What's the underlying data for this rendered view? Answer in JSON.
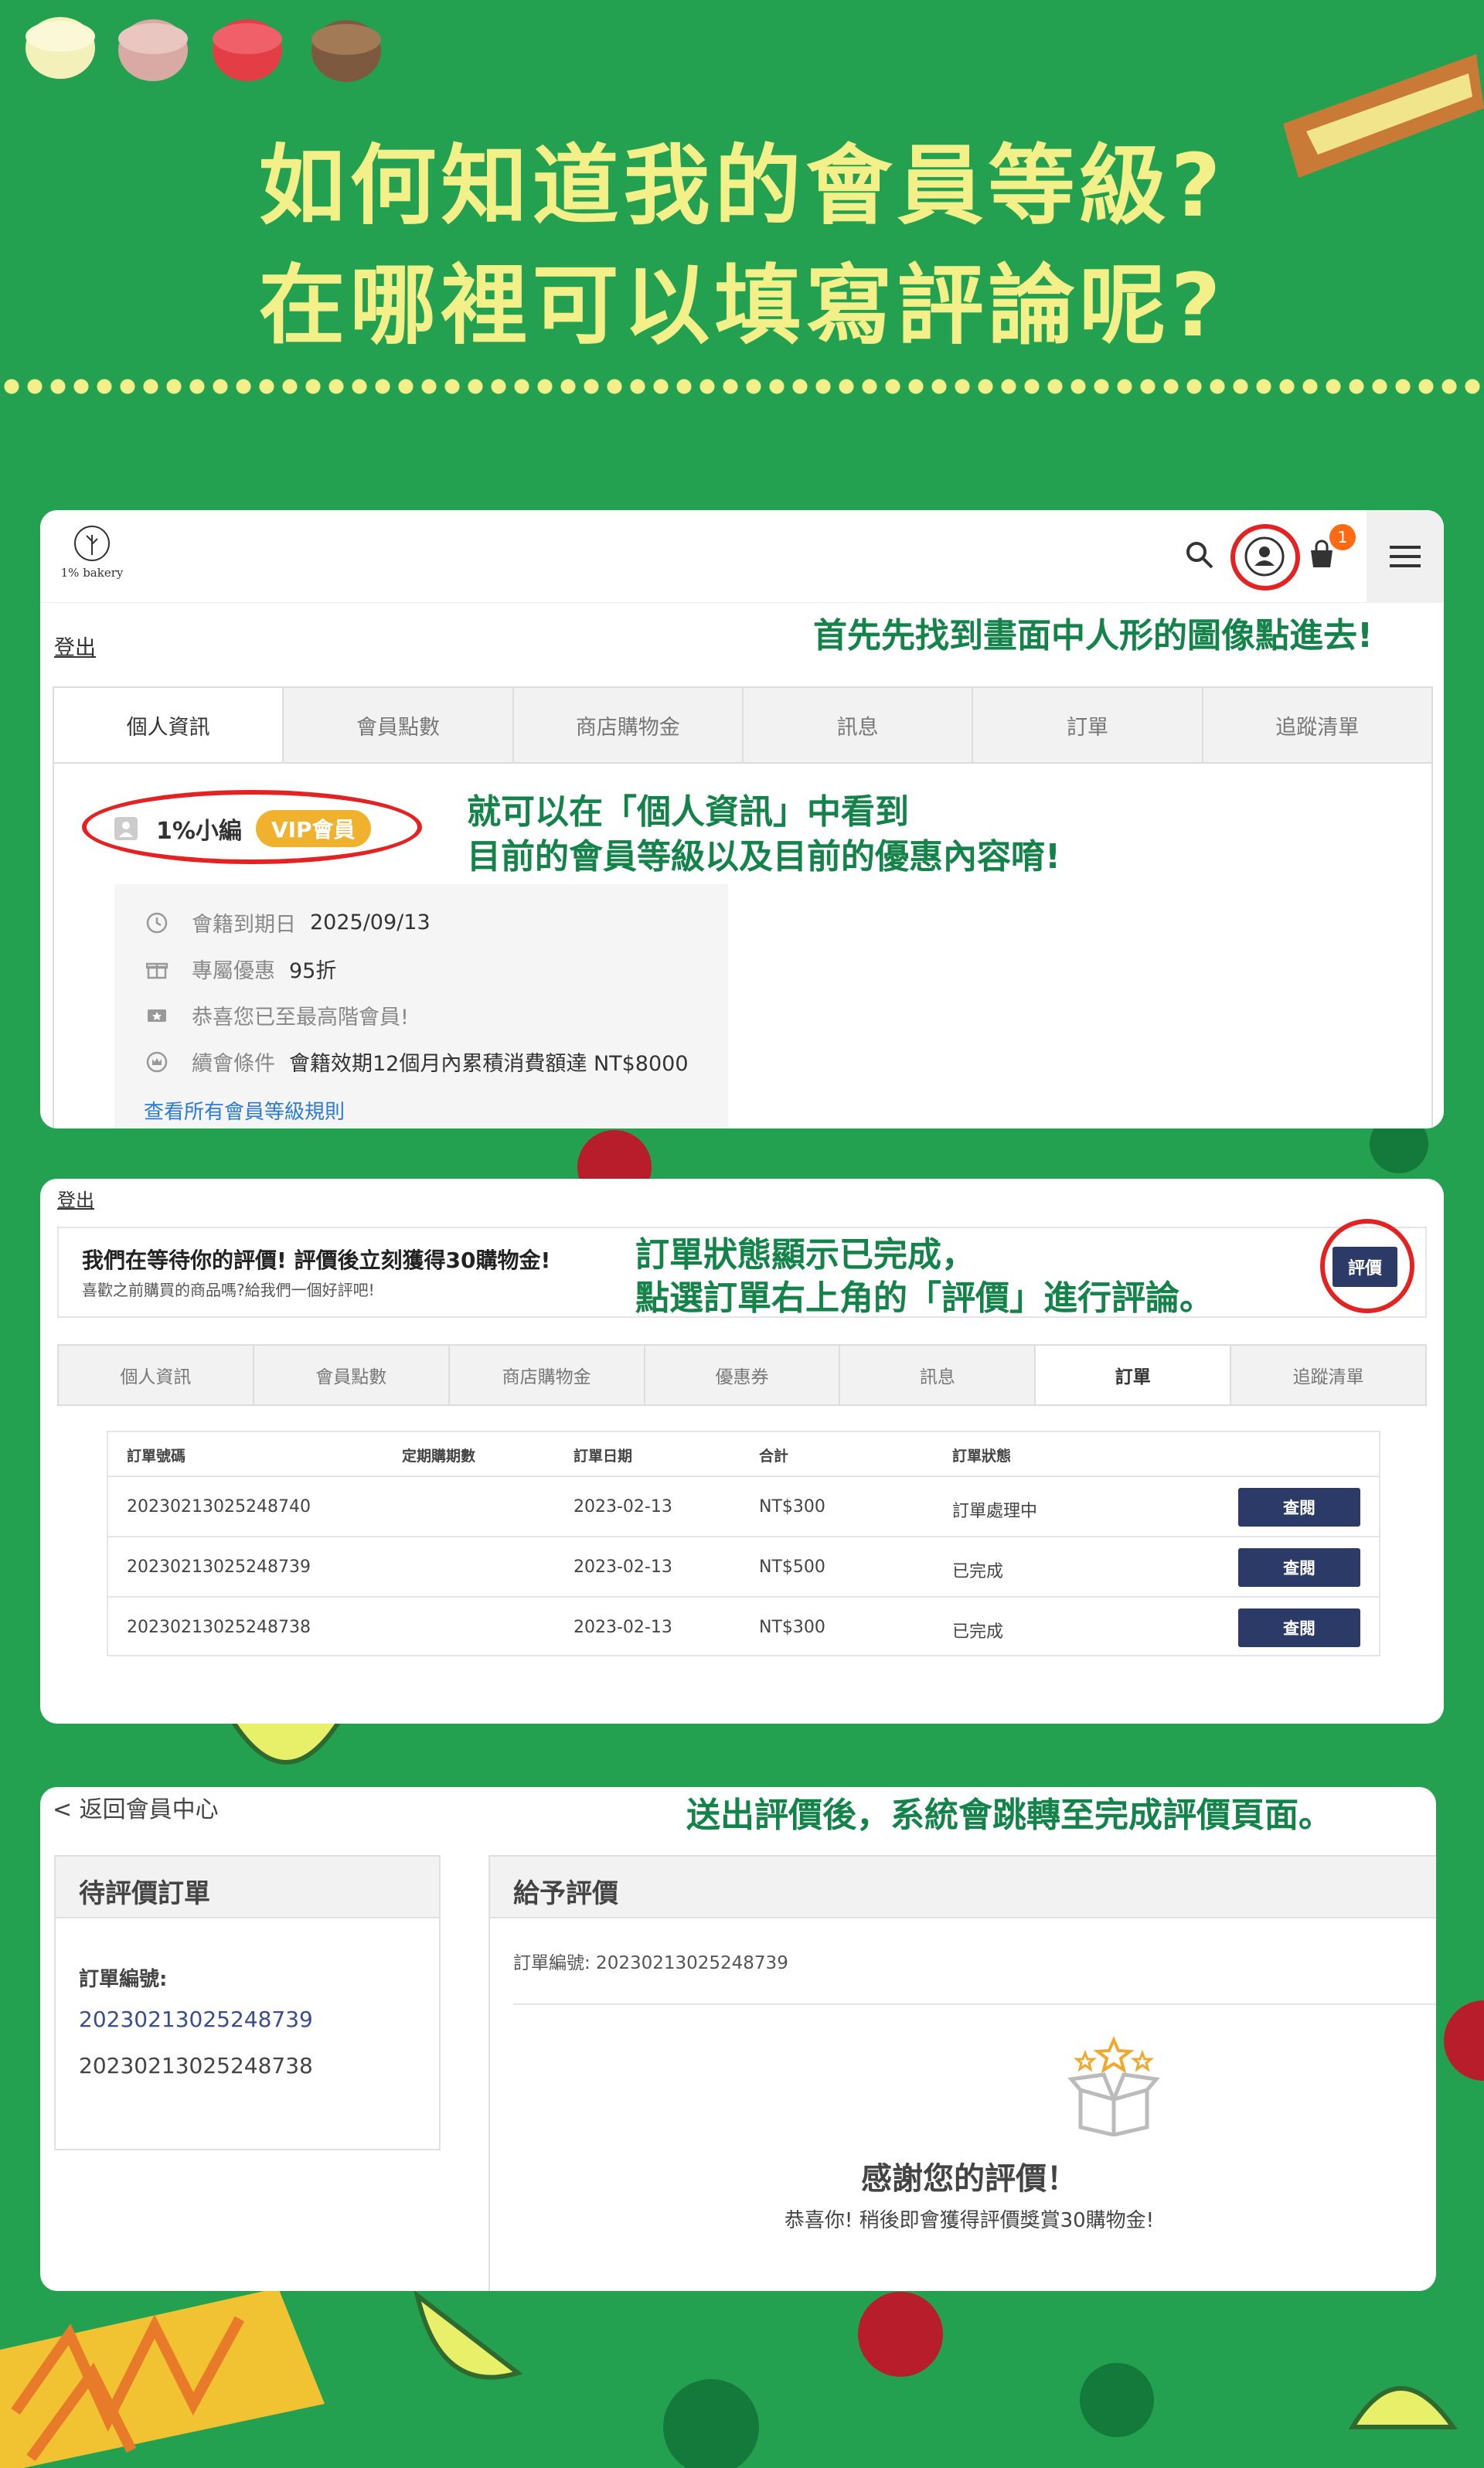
{
  "colors": {
    "background": "#23a150",
    "title": "#f3f08a",
    "callout": "#13834a",
    "highlight": "#e52222",
    "vip": "#f0b22e",
    "button": "#2b3a66",
    "badge": "#ff6a13"
  },
  "hero": {
    "line1": "如何知道我的會員等級?",
    "line2": "在哪裡可以填寫評論呢?"
  },
  "panel1": {
    "logo_text": "1% bakery",
    "cart_count": "1",
    "logout": "登出",
    "callout_top": "首先先找到畫面中人形的圖像點進去!",
    "tabs": [
      "個人資訊",
      "會員點數",
      "商店購物金",
      "訊息",
      "訂單",
      "追蹤清單"
    ],
    "member_name": "1%小編",
    "vip_badge": "VIP會員",
    "callout_mid_1": "就可以在「個人資訊」中看到",
    "callout_mid_2": "目前的會員等級以及目前的優惠內容唷!",
    "info": [
      {
        "icon": "clock-icon",
        "label": "會籍到期日",
        "value": "2025/09/13"
      },
      {
        "icon": "gift-icon",
        "label": "專屬優惠",
        "value": "95折"
      },
      {
        "icon": "ticket-icon",
        "label": "恭喜您已至最高階會員!",
        "value": ""
      },
      {
        "icon": "crown-icon",
        "label": "續會條件",
        "value": "會籍效期12個月內累積消費額達 NT$8000"
      }
    ],
    "rules_link": "查看所有會員等級規則"
  },
  "panel2": {
    "logout": "登出",
    "banner_title": "我們在等待你的評價! 評價後立刻獲得30購物金!",
    "banner_sub": "喜歡之前購買的商品嗎?給我們一個好評吧!",
    "callout_1": "訂單狀態顯示已完成，",
    "callout_2": "點選訂單右上角的「評價」進行評論。",
    "review_button": "評價",
    "tabs": [
      "個人資訊",
      "會員點數",
      "商店購物金",
      "優惠券",
      "訊息",
      "訂單",
      "追蹤清單"
    ],
    "table_headers": [
      "訂單號碼",
      "定期購期數",
      "訂單日期",
      "合計",
      "訂單狀態"
    ],
    "orders": [
      {
        "id": "20230213025248740",
        "period": "",
        "date": "2023-02-13",
        "total": "NT$300",
        "status": "訂單處理中",
        "action": "查閱"
      },
      {
        "id": "20230213025248739",
        "period": "",
        "date": "2023-02-13",
        "total": "NT$500",
        "status": "已完成",
        "action": "查閱"
      },
      {
        "id": "20230213025248738",
        "period": "",
        "date": "2023-02-13",
        "total": "NT$300",
        "status": "已完成",
        "action": "查閱"
      }
    ]
  },
  "panel3": {
    "back_link": "< 返回會員中心",
    "callout": "送出評價後，系統會跳轉至完成評價頁面。",
    "pending_title": "待評價訂單",
    "order_label": "訂單編號:",
    "pending_orders": [
      "20230213025248739",
      "20230213025248738"
    ],
    "review_title": "給予評價",
    "review_order": "訂單編號: 20230213025248739",
    "thanks_title": "感謝您的評價！",
    "thanks_sub": "恭喜你! 稍後即會獲得評價獎賞30購物金!"
  }
}
